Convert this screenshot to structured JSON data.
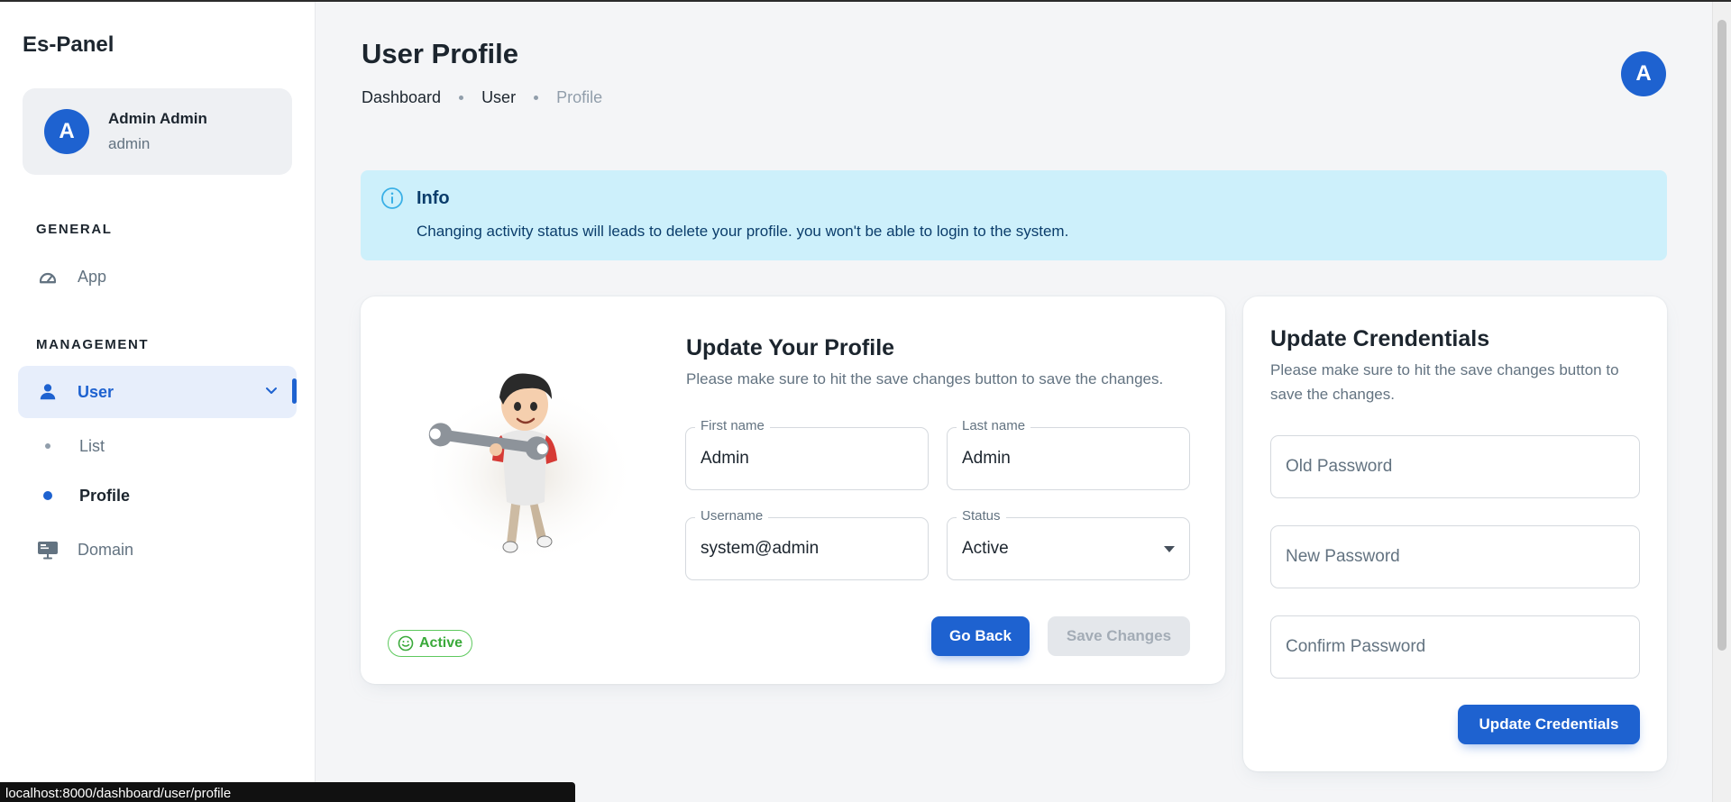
{
  "sidebar": {
    "brand": "Es-Panel",
    "account": {
      "avatar_letter": "A",
      "name": "Admin Admin",
      "role": "admin"
    },
    "general_heading": "GENERAL",
    "management_heading": "MANAGEMENT",
    "items": {
      "app": {
        "label": "App",
        "icon": "dashboard-gauge-icon"
      },
      "user": {
        "label": "User",
        "icon": "person-icon",
        "expanded": true
      },
      "list": {
        "label": "List"
      },
      "profile": {
        "label": "Profile",
        "active": true
      },
      "domain": {
        "label": "Domain",
        "icon": "monitor-icon"
      }
    }
  },
  "header": {
    "title": "User Profile",
    "breadcrumb": [
      "Dashboard",
      "User",
      "Profile"
    ],
    "avatar_letter": "A"
  },
  "alert": {
    "title": "Info",
    "text": "Changing activity status will leads to delete your profile. you won't be able to login to the system."
  },
  "profile_card": {
    "title": "Update Your Profile",
    "subtitle": "Please make sure to hit the save changes button to save the changes.",
    "status_chip": "Active",
    "fields": {
      "first_name": {
        "label": "First name",
        "value": "Admin"
      },
      "last_name": {
        "label": "Last name",
        "value": "Admin"
      },
      "username": {
        "label": "Username",
        "value": "system@admin"
      },
      "status": {
        "label": "Status",
        "value": "Active"
      }
    },
    "go_back_label": "Go Back",
    "save_label": "Save Changes"
  },
  "credentials_card": {
    "title": "Update Crendentials",
    "subtitle": "Please make sure to hit the save changes button to save the changes.",
    "old_password_placeholder": "Old Password",
    "new_password_placeholder": "New Password",
    "confirm_password_placeholder": "Confirm Password",
    "submit_label": "Update Credentials"
  },
  "status_bar_url": "localhost:8000/dashboard/user/profile",
  "colors": {
    "primary": "#1e62d0",
    "alert_bg": "#cdf0fb",
    "success": "#3aa93a"
  }
}
